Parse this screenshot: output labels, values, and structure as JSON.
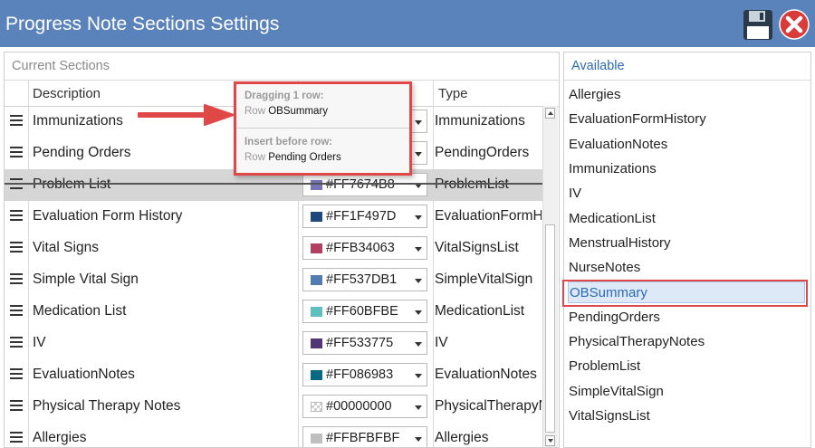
{
  "window": {
    "title": "Progress Note Sections Settings",
    "save_icon": "floppy-disk-icon",
    "close_icon": "close-x-icon",
    "title_bar_color": "#5b83bb"
  },
  "current_sections": {
    "label": "Current Sections",
    "columns": {
      "description": "Description",
      "type": "Type"
    },
    "rows": [
      {
        "description": "Immunizations",
        "color": "",
        "type": "Immunizations",
        "swatch": ""
      },
      {
        "description": "Pending Orders",
        "color": "",
        "type": "PendingOrders",
        "swatch": ""
      },
      {
        "description": "Problem List",
        "color": "#FF7674B8",
        "type": "ProblemList",
        "swatch": "#7674B8",
        "selected": true
      },
      {
        "description": "Evaluation Form History",
        "color": "#FF1F497D",
        "type": "EvaluationFormH",
        "swatch": "#1F497D"
      },
      {
        "description": "Vital Signs",
        "color": "#FFB34063",
        "type": "VitalSignsList",
        "swatch": "#B34063"
      },
      {
        "description": "Simple Vital Sign",
        "color": "#FF537DB1",
        "type": "SimpleVitalSign",
        "swatch": "#537DB1"
      },
      {
        "description": "Medication List",
        "color": "#FF60BFBE",
        "type": "MedicationList",
        "swatch": "#60BFBE"
      },
      {
        "description": "IV",
        "color": "#FF533775",
        "type": "IV",
        "swatch": "#533775"
      },
      {
        "description": "EvaluationNotes",
        "color": "#FF086983",
        "type": "EvaluationNotes",
        "swatch": "#086983"
      },
      {
        "description": "Physical Therapy Notes",
        "color": "#00000000",
        "type": "PhysicalTherapyN",
        "swatch": "transparent"
      },
      {
        "description": "Allergies",
        "color": "#FFBFBFBF",
        "type": "Allergies",
        "swatch": "#BFBFBF"
      }
    ]
  },
  "drag_tooltip": {
    "dragging_label": "Dragging 1 row:",
    "row_prefix": "Row",
    "dragging_row": "OBSummary",
    "insert_label": "Insert before row:",
    "insert_row": "Pending Orders"
  },
  "available": {
    "label": "Available",
    "items": [
      "Allergies",
      "EvaluationFormHistory",
      "EvaluationNotes",
      "Immunizations",
      "IV",
      "MedicationList",
      "MenstrualHistory",
      "NurseNotes",
      "OBSummary",
      "PendingOrders",
      "PhysicalTherapyNotes",
      "ProblemList",
      "SimpleVitalSign",
      "VitalSignsList"
    ],
    "selected_item": "OBSummary"
  },
  "accent_color": "#e04848"
}
